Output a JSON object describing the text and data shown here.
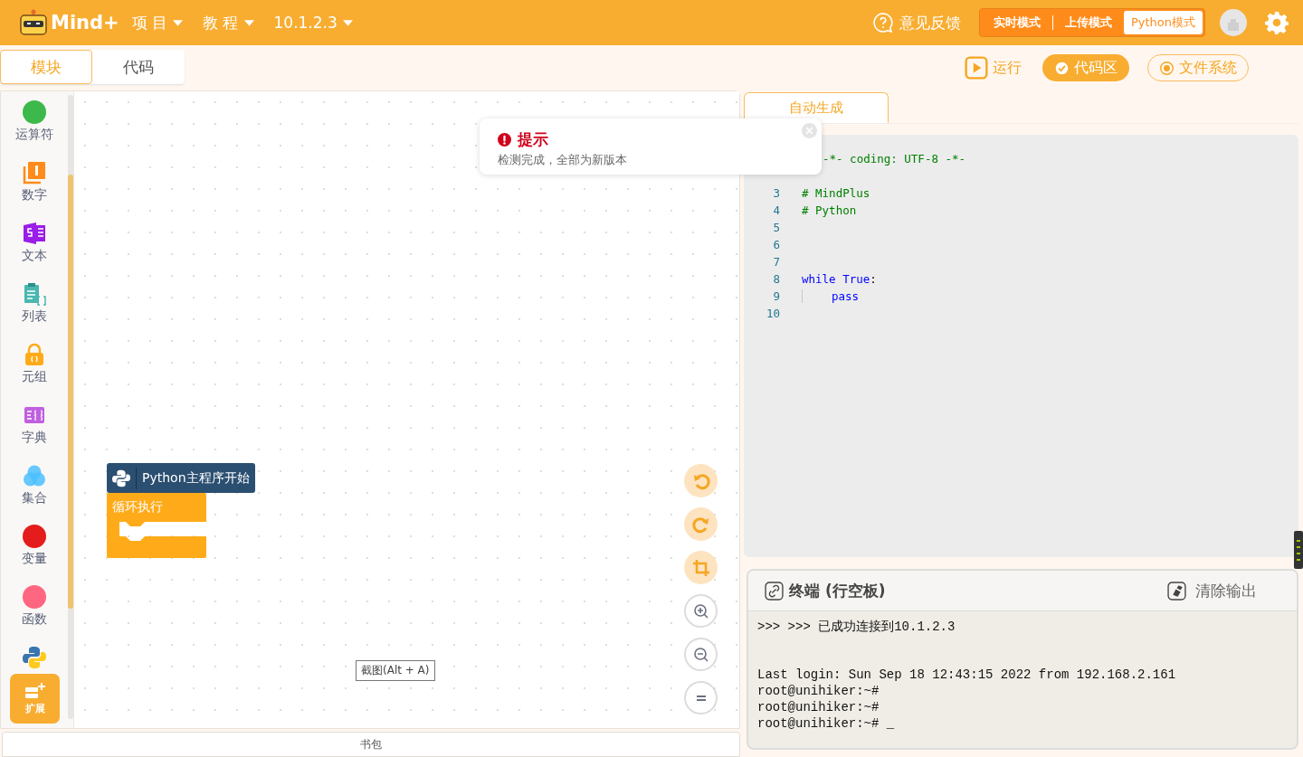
{
  "header": {
    "logo": "Mind+",
    "menus": [
      {
        "label": "项 目"
      },
      {
        "label": "教 程"
      },
      {
        "label": "10.1.2.3"
      }
    ],
    "feedback": "意见反馈",
    "modes": [
      {
        "label": "实时模式",
        "selected": false
      },
      {
        "label": "上传模式",
        "selected": false
      },
      {
        "label": "Python模式",
        "selected": true
      }
    ]
  },
  "view_tabs": [
    {
      "label": "模块",
      "selected": true
    },
    {
      "label": "代码",
      "selected": false
    }
  ],
  "toolbar": [
    {
      "label": "运行",
      "kind": "run",
      "selected": false
    },
    {
      "label": "代码区",
      "kind": "check",
      "selected": true
    },
    {
      "label": "文件系统",
      "kind": "radio",
      "selected": false
    }
  ],
  "categories": [
    {
      "label": "运算符",
      "kind": "dot",
      "color": "#3cb94a"
    },
    {
      "label": "数字",
      "kind": "number"
    },
    {
      "label": "文本",
      "kind": "text"
    },
    {
      "label": "列表",
      "kind": "list"
    },
    {
      "label": "元组",
      "kind": "tuple"
    },
    {
      "label": "字典",
      "kind": "dict"
    },
    {
      "label": "集合",
      "kind": "set"
    },
    {
      "label": "变量",
      "kind": "dot",
      "color": "#e41c1c"
    },
    {
      "label": "函数",
      "kind": "dot",
      "color": "#ff6680"
    },
    {
      "kind": "python"
    }
  ],
  "extend_button": "扩展",
  "blocks": {
    "hat": "Python主程序开始",
    "loop": "循环执行"
  },
  "screenshot_hint": "截图(Alt + A)",
  "backpack": "书包",
  "toast": {
    "title": "提示",
    "message": "检测完成，全部为新版本"
  },
  "code_tab": {
    "label": "自动生成",
    "selected": true
  },
  "code_lines": [
    {
      "tokens": [
        {
          "text": "-*- coding: UTF-8 -*-",
          "kind": "comment"
        }
      ],
      "kind": "covered"
    },
    {
      "number": "3",
      "tokens": [
        {
          "text": "# MindPlus",
          "kind": "comment"
        }
      ]
    },
    {
      "number": "4",
      "tokens": [
        {
          "text": "# Python",
          "kind": "comment"
        }
      ]
    },
    {
      "number": "5"
    },
    {
      "number": "6"
    },
    {
      "number": "7"
    },
    {
      "number": "8",
      "tokens": [
        {
          "text": "while True",
          "kind": "keyword"
        },
        {
          "text": ":",
          "kind": "plain"
        }
      ]
    },
    {
      "number": "9",
      "tokens": [
        {
          "text": "pass",
          "kind": "keyword"
        }
      ],
      "kind": "indented"
    },
    {
      "number": "10"
    }
  ],
  "terminal": {
    "title": "终端 (行空板)",
    "clear": "清除输出",
    "lines": [
      ">>> >>> 已成功连接到10.1.2.3",
      "Last login: Sun Sep 18 12:43:15 2022 from 192.168.2.161",
      "root@unihiker:~#",
      "root@unihiker:~#",
      "root@unihiker:~# _"
    ]
  }
}
